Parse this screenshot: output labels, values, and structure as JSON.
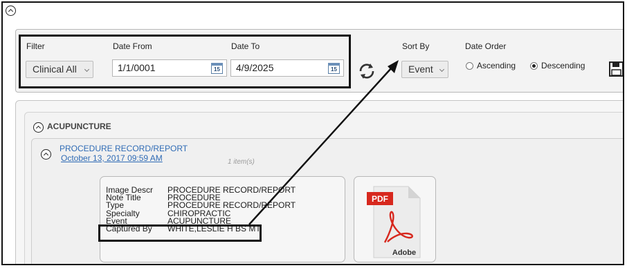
{
  "toolbar": {
    "filter_label": "Filter",
    "filter_value": "Clinical All",
    "date_from_label": "Date From",
    "date_from_value": "1/1/0001",
    "date_to_label": "Date To",
    "date_to_value": "4/9/2025",
    "calendar_icon_text": "15",
    "sort_by_label": "Sort By",
    "sort_by_value": "Event",
    "date_order_label": "Date Order",
    "ascending_label": "Ascending",
    "descending_label": "Descending",
    "selected_order": "Descending"
  },
  "group": {
    "title": "ACUPUNCTURE"
  },
  "record": {
    "title": "PROCEDURE RECORD/REPORT",
    "date": "October 13, 2017 09:59 AM",
    "item_count": "1 item(s)"
  },
  "details": [
    {
      "label": "Image Descr",
      "value": "PROCEDURE RECORD/REPORT"
    },
    {
      "label": "Note Title",
      "value": "PROCEDURE"
    },
    {
      "label": "Type",
      "value": "PROCEDURE RECORD/REPORT"
    },
    {
      "label": "Specialty",
      "value": "CHIROPRACTIC"
    },
    {
      "label": "Event",
      "value": "ACUPUNCTURE"
    },
    {
      "label": "Captured By",
      "value": "WHITE,LESLIE H BS MT"
    }
  ],
  "pdf_thumb": {
    "badge": "PDF",
    "brand": "Adobe",
    "badge_color": "#d7281e"
  },
  "icons": {
    "collapse": "chevron-up-circle-icon",
    "refresh": "refresh-icon",
    "save": "save-icon",
    "calendar": "calendar-icon"
  }
}
